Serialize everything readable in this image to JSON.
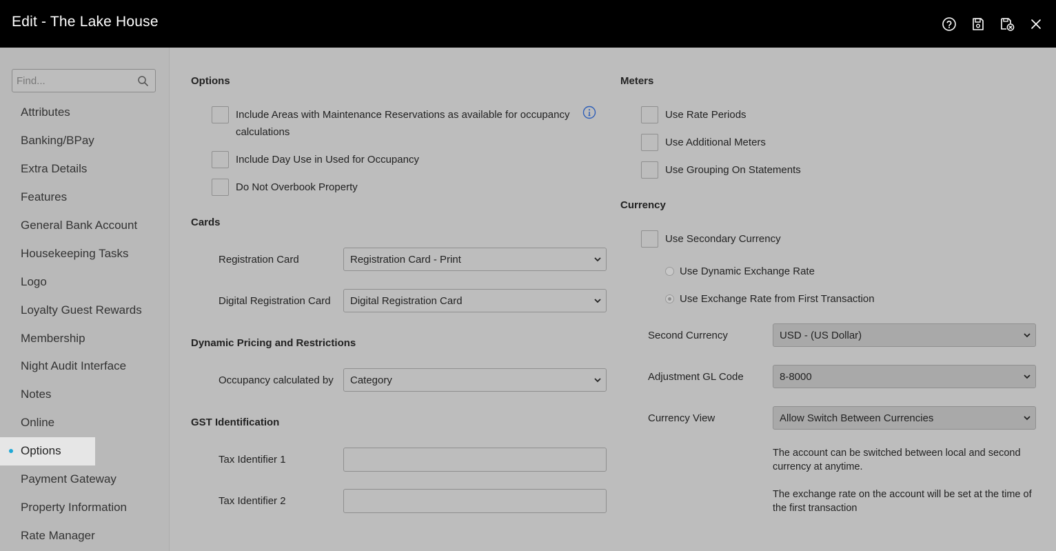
{
  "window": {
    "title": "Edit - The Lake House"
  },
  "toolbar": {
    "icons": [
      "help-icon",
      "save-icon",
      "save-close-icon",
      "close-icon"
    ]
  },
  "sidebar": {
    "search_placeholder": "Find...",
    "items": [
      {
        "label": "Attributes"
      },
      {
        "label": "Banking/BPay"
      },
      {
        "label": "Extra Details"
      },
      {
        "label": "Features"
      },
      {
        "label": "General Bank Account"
      },
      {
        "label": "Housekeeping Tasks"
      },
      {
        "label": "Logo"
      },
      {
        "label": "Loyalty Guest Rewards"
      },
      {
        "label": "Membership"
      },
      {
        "label": "Night Audit Interface"
      },
      {
        "label": "Notes"
      },
      {
        "label": "Online"
      },
      {
        "label": "Options",
        "active": true
      },
      {
        "label": "Payment Gateway"
      },
      {
        "label": "Property Information"
      },
      {
        "label": "Rate Manager"
      }
    ]
  },
  "options": {
    "title": "Options",
    "include_maintenance": "Include Areas with Maintenance Reservations as available for occupancy",
    "include_maintenance_2": "calculations",
    "include_day_use": "Include Day Use in Used for Occupancy",
    "do_not_overbook": "Do Not Overbook Property"
  },
  "cards": {
    "title": "Cards",
    "registration_label": "Registration Card",
    "registration_value": "Registration Card - Print",
    "digital_label": "Digital Registration Card",
    "digital_value": "Digital Registration Card"
  },
  "pricing": {
    "title": "Dynamic Pricing and Restrictions",
    "occupancy_label": "Occupancy calculated by",
    "occupancy_value": "Category"
  },
  "gst": {
    "title": "GST Identification",
    "tax1_label": "Tax Identifier 1",
    "tax1_value": "",
    "tax2_label": "Tax Identifier 2",
    "tax2_value": ""
  },
  "meters": {
    "title": "Meters",
    "use_rate_periods": "Use Rate Periods",
    "use_additional_meters": "Use Additional Meters",
    "use_grouping": "Use Grouping On Statements"
  },
  "currency": {
    "title": "Currency",
    "use_secondary": "Use Secondary Currency",
    "dynamic_rate": "Use Dynamic Exchange Rate",
    "first_transaction_rate": "Use Exchange Rate from First Transaction",
    "second_currency_label": "Second Currency",
    "second_currency_value": "USD - (US Dollar)",
    "adjustment_label": "Adjustment GL Code",
    "adjustment_value": "8-8000",
    "view_label": "Currency View",
    "view_value": "Allow Switch Between Currencies",
    "note1": "The account can be switched between local and second currency at anytime.",
    "note2": "The exchange rate on the account will be set at the time of the first transaction"
  }
}
